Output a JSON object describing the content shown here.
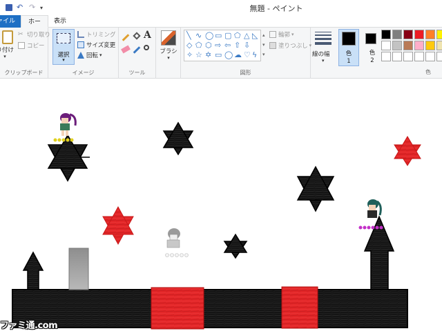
{
  "window": {
    "title": "無題 - ペイント"
  },
  "tabs": {
    "file": "ファイル",
    "home": "ホーム",
    "view": "表示"
  },
  "ribbon": {
    "clipboard": {
      "label": "クリップボード",
      "paste": "貼り付け",
      "cut": "切り取り",
      "copy": "コピー"
    },
    "image": {
      "label": "イメージ",
      "select": "選択",
      "crop": "トリミング",
      "resize": "サイズ変更",
      "rotate": "回転"
    },
    "tools": {
      "label": "ツール"
    },
    "brushes": {
      "label": "ブラシ"
    },
    "shapes": {
      "label": "図形",
      "outline": "輪郭",
      "fill": "塗りつぶし"
    },
    "size": {
      "label": "線の幅"
    },
    "colors": {
      "label": "色",
      "color1": "色\n1",
      "color1_a": "色",
      "color1_b": "1",
      "color2_a": "色",
      "color2_b": "2"
    }
  },
  "palette": [
    "#000000",
    "#7f7f7f",
    "#880015",
    "#ed1c24",
    "#ff7f27",
    "#fff200",
    "#ffffff",
    "#c3c3c3",
    "#b97a57",
    "#ffaec9",
    "#ffc90e",
    "#efe4b0",
    "#ffffff",
    "#ffffff",
    "#ffffff",
    "#ffffff",
    "#ffffff",
    "#ffffff"
  ],
  "accent": "#1e6fc4",
  "watermark": "ファミ通.com"
}
